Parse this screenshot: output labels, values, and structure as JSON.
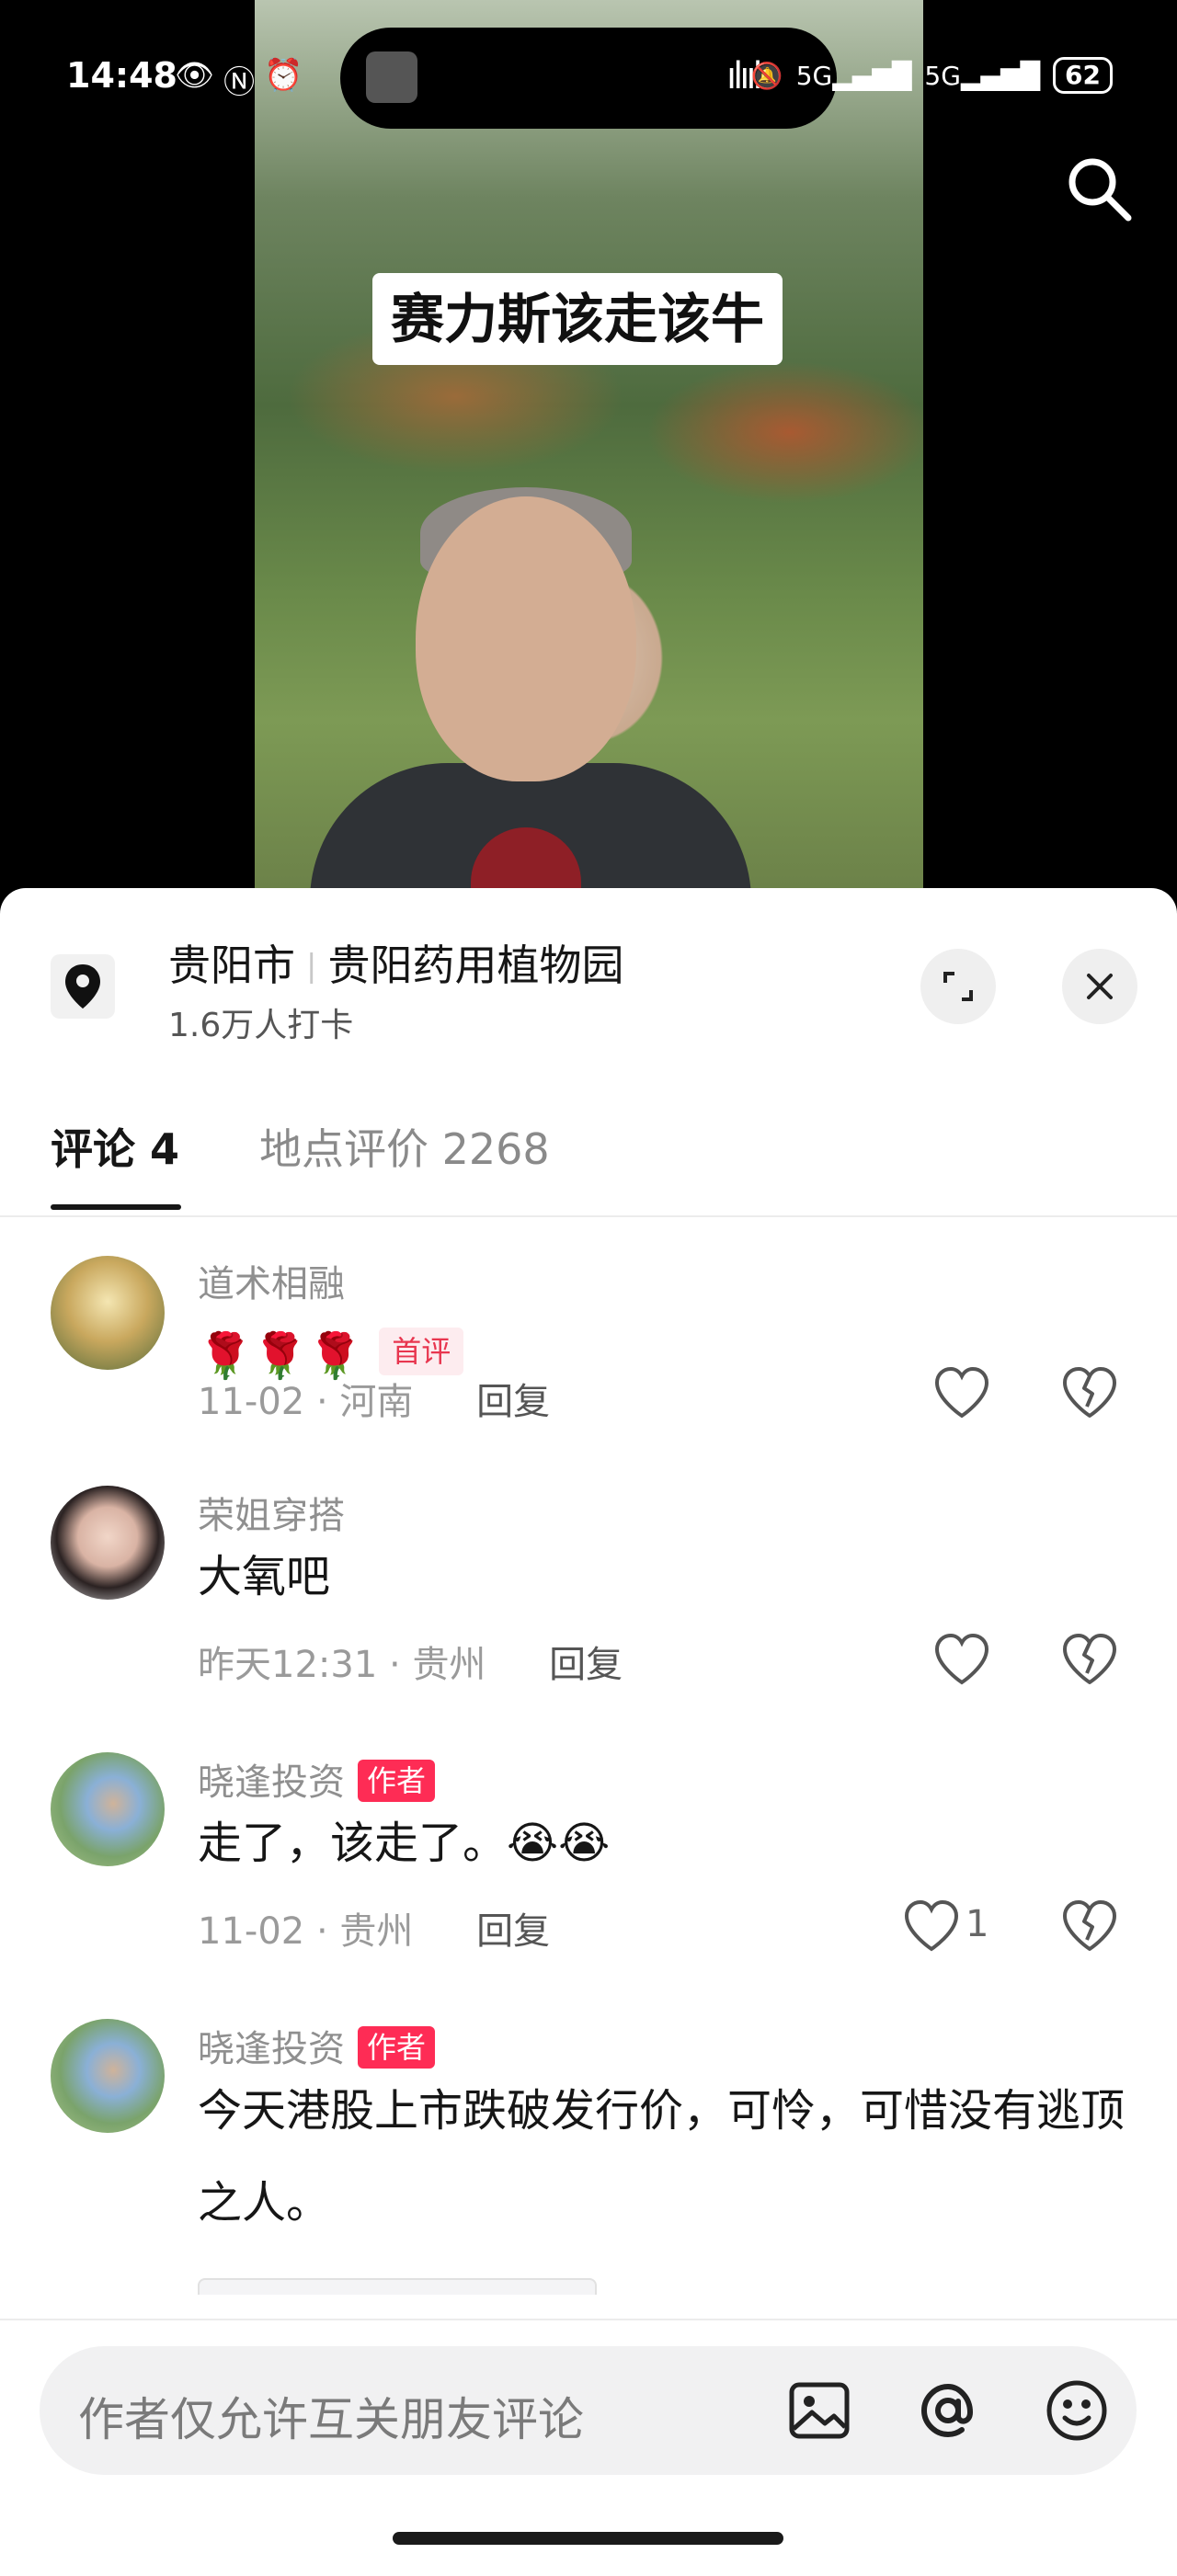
{
  "status_bar": {
    "time": "14:48",
    "left_icons": [
      "eye-icon",
      "nfc-icon",
      "alarm-icon"
    ],
    "right_icons": [
      "silent-icon",
      "5g-signal-icon",
      "5g-signal-icon"
    ],
    "battery": "62"
  },
  "video": {
    "caption": "赛力斯该走该牛"
  },
  "location": {
    "city": "贵阳市",
    "place": "贵阳药用植物园",
    "checkins": "1.6万人打卡"
  },
  "tabs": [
    {
      "label": "评论 4",
      "active": true
    },
    {
      "label": "地点评价 2268",
      "active": false
    }
  ],
  "comments": [
    {
      "user": "道术相融",
      "is_author": false,
      "text": "🌹🌹🌹",
      "badge": "首评",
      "date": "11-02",
      "region": "河南",
      "reply": "回复",
      "likes": ""
    },
    {
      "user": "荣姐穿搭",
      "is_author": false,
      "text": "大氧吧",
      "date": "昨天12:31",
      "region": "贵州",
      "reply": "回复",
      "likes": ""
    },
    {
      "user": "晓逢投资",
      "is_author": true,
      "author_label": "作者",
      "text": "走了，该走了。😭😭",
      "date": "11-02",
      "region": "贵州",
      "reply": "回复",
      "likes": "1"
    },
    {
      "user": "晓逢投资",
      "is_author": true,
      "author_label": "作者",
      "text": "今天港股上市跌破发行价，可怜，可惜没有逃顶之人。"
    }
  ],
  "meta_separator": "·",
  "input": {
    "placeholder": "作者仅允许互关朋友评论",
    "icons": [
      "image-icon",
      "at-icon",
      "emoji-icon"
    ]
  },
  "colors": {
    "author_badge": "#fe2c55",
    "first_badge_text": "#e8364f",
    "sheet_bg": "#ffffff"
  }
}
